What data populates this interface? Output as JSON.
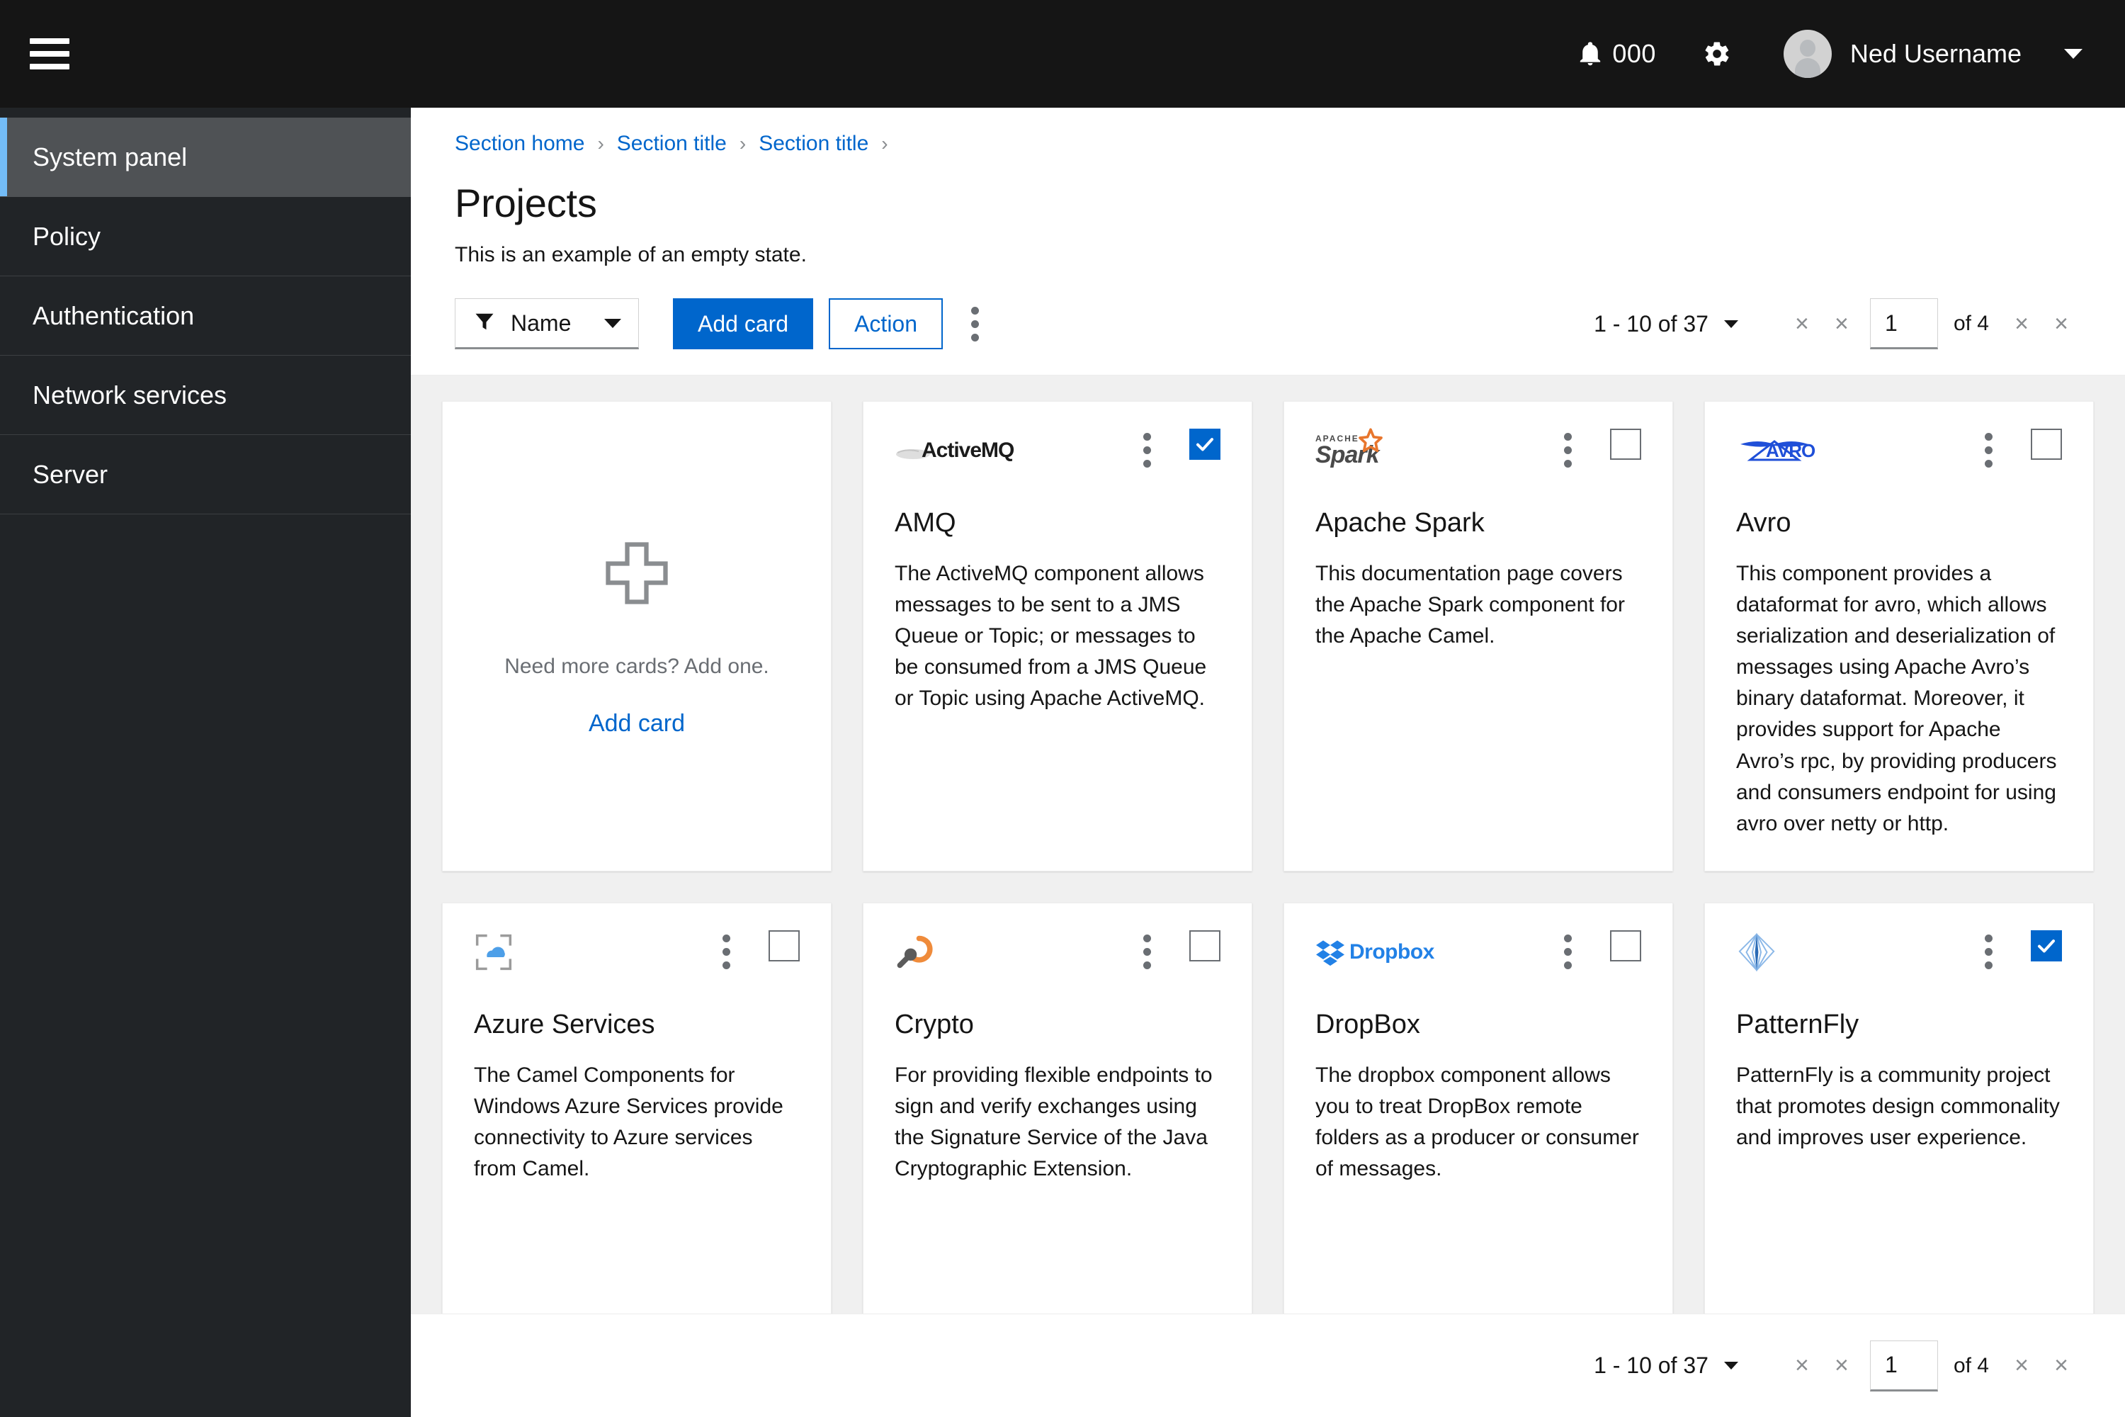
{
  "masthead": {
    "menu_icon": "hamburger-icon",
    "notification_count": "000",
    "notification_icon": "bell-icon",
    "settings_icon": "gear-icon",
    "avatar_icon": "user-avatar-icon",
    "username": "Ned Username",
    "user_caret_icon": "caret-down-icon"
  },
  "sidebar": {
    "items": [
      {
        "label": "System panel",
        "current": true
      },
      {
        "label": "Policy",
        "current": false
      },
      {
        "label": "Authentication",
        "current": false
      },
      {
        "label": "Network services",
        "current": false
      },
      {
        "label": "Server",
        "current": false
      }
    ]
  },
  "page": {
    "breadcrumb": [
      {
        "label": "Section home"
      },
      {
        "label": "Section title"
      },
      {
        "label": "Section title"
      }
    ],
    "breadcrumb_separator": "›",
    "title": "Projects",
    "subtitle": "This is an example of an empty state."
  },
  "toolbar": {
    "filter_icon": "filter-icon",
    "filter_value": "Name",
    "filter_caret_icon": "caret-down-icon",
    "add_card_label": "Add card",
    "action_label": "Action",
    "kebab_icon": "kebab-vertical-icon"
  },
  "pagination": {
    "range_prefix": "1 - 10 of ",
    "total": "37",
    "range_full": "1 - 10 of 37",
    "dropdown_caret_icon": "caret-down-icon",
    "first_page_icon": "angle-double-left-icon",
    "prev_page_icon": "angle-left-icon",
    "page_value": "1",
    "of_pages": "of 4",
    "next_page_icon": "angle-right-icon",
    "last_page_icon": "angle-double-right-icon",
    "arrow_glyph": "×"
  },
  "empty_card": {
    "plus_icon": "plus-icon",
    "text": "Need more cards? Add one.",
    "link_label": "Add card"
  },
  "cards": [
    {
      "logo": "activemq-logo",
      "logo_text": "ActiveMQ",
      "title": "AMQ",
      "description": "The ActiveMQ component allows messages to be sent to a JMS Queue or Topic; or messages to be consumed from a JMS Queue or Topic using Apache ActiveMQ.",
      "checked": true,
      "kebab_icon": "kebab-vertical-icon",
      "checkbox_icon": "checkbox-checked-icon"
    },
    {
      "logo": "apache-spark-logo",
      "logo_text": "Spark",
      "logo_sup": "APACHE",
      "title": "Apache Spark",
      "description": "This documentation page covers the Apache Spark component for the Apache Camel.",
      "checked": false,
      "kebab_icon": "kebab-vertical-icon",
      "checkbox_icon": "checkbox-unchecked-icon"
    },
    {
      "logo": "avro-logo",
      "logo_text": "AVRO",
      "title": "Avro",
      "description": "This component provides a dataformat for avro, which allows serialization and deserialization of messages using Apache Avro’s binary dataformat. Moreover, it provides support for Apache Avro’s rpc, by providing producers and consumers endpoint for using avro over netty or http.",
      "checked": false,
      "kebab_icon": "kebab-vertical-icon",
      "checkbox_icon": "checkbox-unchecked-icon"
    },
    {
      "logo": "azure-services-logo",
      "logo_text": "",
      "title": "Azure Services",
      "description": "The Camel Components for Windows Azure Services provide connectivity to Azure services from Camel.",
      "checked": false,
      "kebab_icon": "kebab-vertical-icon",
      "checkbox_icon": "checkbox-unchecked-icon"
    },
    {
      "logo": "crypto-logo",
      "logo_text": "",
      "title": "Crypto",
      "description": "For providing flexible endpoints to sign and verify exchanges using the Signature Service of the Java Cryptographic Extension.",
      "checked": false,
      "kebab_icon": "kebab-vertical-icon",
      "checkbox_icon": "checkbox-unchecked-icon"
    },
    {
      "logo": "dropbox-logo",
      "logo_text": "Dropbox",
      "title": "DropBox",
      "description": "The dropbox component allows you to treat DropBox remote folders as a producer or consumer of messages.",
      "checked": false,
      "kebab_icon": "kebab-vertical-icon",
      "checkbox_icon": "checkbox-unchecked-icon"
    },
    {
      "logo": "patternfly-logo",
      "logo_text": "",
      "title": "PatternFly",
      "description": "PatternFly is a community project that promotes design commonality and improves user experience.",
      "checked": true,
      "kebab_icon": "kebab-vertical-icon",
      "checkbox_icon": "checkbox-checked-icon"
    }
  ],
  "colors": {
    "masthead_bg": "#151515",
    "sidebar_bg": "#212427",
    "sidebar_current_bg": "#4f5255",
    "accent_blue": "#0066cc",
    "link_blue": "#06c",
    "current_indicator": "#73bcf7",
    "content_bg": "#f0f0f0",
    "muted_text": "#6a6e73"
  }
}
